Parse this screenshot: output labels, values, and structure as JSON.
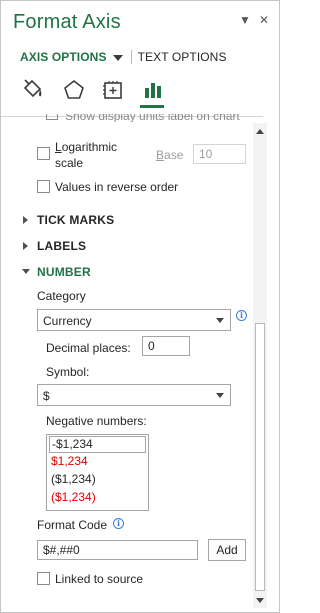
{
  "pane": {
    "title": "Format Axis",
    "header_icons": [
      "chevron-down-icon",
      "close-icon"
    ],
    "header_glyphs": {
      "dropdown": "▼",
      "close": "✕"
    }
  },
  "tabs": {
    "axis_options": "AXIS OPTIONS",
    "text_options": "TEXT OPTIONS"
  },
  "icon_tabs": [
    "fill-line-icon",
    "effects-icon",
    "size-properties-icon",
    "axis-options-icon"
  ],
  "accent_color": "#217346",
  "axis_options": {
    "cut_off_label": "Show display units label on chart",
    "logarithmic": {
      "label": "Logarithmic scale",
      "line1": "Logarithmic",
      "line2": "scale",
      "checked": false
    },
    "base": {
      "label": "Base",
      "value": "10"
    },
    "reverse_order": {
      "label": "Values in reverse order",
      "checked": false
    }
  },
  "sections": {
    "tick_marks": "TICK MARKS",
    "labels": "LABELS",
    "number": "NUMBER"
  },
  "number": {
    "category_label": "Category",
    "category_value": "Currency",
    "decimal_places_label": "Decimal places:",
    "decimal_places_value": "0",
    "symbol_label": "Symbol:",
    "symbol_value": "$",
    "negative_numbers_label": "Negative numbers:",
    "negative_numbers": [
      {
        "text": "-$1,234",
        "color": "#262626",
        "selected": true
      },
      {
        "text": "$1,234",
        "color": "#e00000",
        "selected": false
      },
      {
        "text": "($1,234)",
        "color": "#262626",
        "selected": false
      },
      {
        "text": "($1,234)",
        "color": "#e00000",
        "selected": false
      }
    ],
    "format_code_label": "Format Code",
    "format_code_value": "$#,##0",
    "add_button": "Add",
    "linked_to_source": {
      "label": "Linked to source",
      "checked": false
    },
    "info_glyph": "i"
  }
}
